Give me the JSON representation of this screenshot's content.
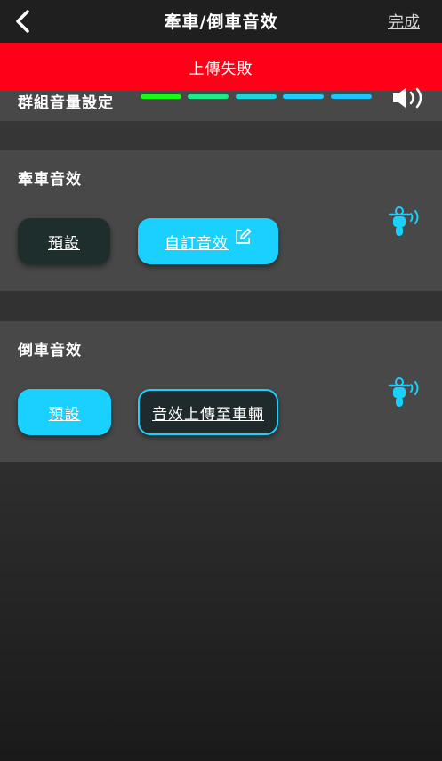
{
  "header": {
    "title": "牽車/倒車音效",
    "done_label": "完成",
    "back_icon": "chevron-left-icon"
  },
  "banner": {
    "message": "上傳失敗",
    "color": "#ff0019"
  },
  "volume": {
    "label": "群組音量設定",
    "segment_colors": [
      "#12ff12",
      "#1aee8a",
      "#1ad8e0",
      "#1ad0ff",
      "#1ac6ff"
    ],
    "speaker_icon": "speaker-volume-icon"
  },
  "push_sound": {
    "title": "牽車音效",
    "default_label": "預設",
    "custom_label": "自訂音效",
    "selected": "default",
    "edit_icon": "edit-icon",
    "play_icon": "scooter-sound-icon"
  },
  "reverse_sound": {
    "title": "倒車音效",
    "default_label": "預設",
    "upload_label": "音效上傳至車輛",
    "selected": "default",
    "play_icon": "scooter-sound-icon"
  },
  "colors": {
    "accent": "#1ad0ff",
    "dark_button": "#1e2e2d",
    "section_bg": "#484848"
  }
}
